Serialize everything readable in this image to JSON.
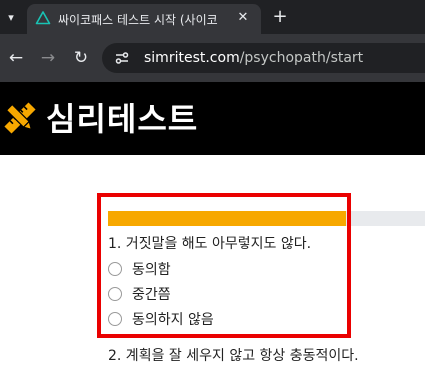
{
  "browser": {
    "tab": {
      "title": "싸이코패스 테스트 시작 (사이코",
      "close_glyph": "✕",
      "favicon_icon": "triangle-icon"
    },
    "new_tab_glyph": "+",
    "nav": {
      "back_glyph": "←",
      "forward_glyph": "→",
      "reload_glyph": "↻"
    },
    "address": {
      "domain": "simritest.com",
      "path": "/psychopath/start"
    }
  },
  "site": {
    "logo_text": "심리테스트",
    "logo_icon": "pencil-ruler-icon"
  },
  "quiz": {
    "progress_percent": 72,
    "progress_color": "#f7a800",
    "highlight_color": "#ea0000",
    "question": "1. 거짓말을 해도 아무렇지도 않다.",
    "options": [
      "동의함",
      "중간쯤",
      "동의하지 않음"
    ],
    "next_question": "2. 계획을 잘 세우지 않고 항상 충동적이다."
  }
}
